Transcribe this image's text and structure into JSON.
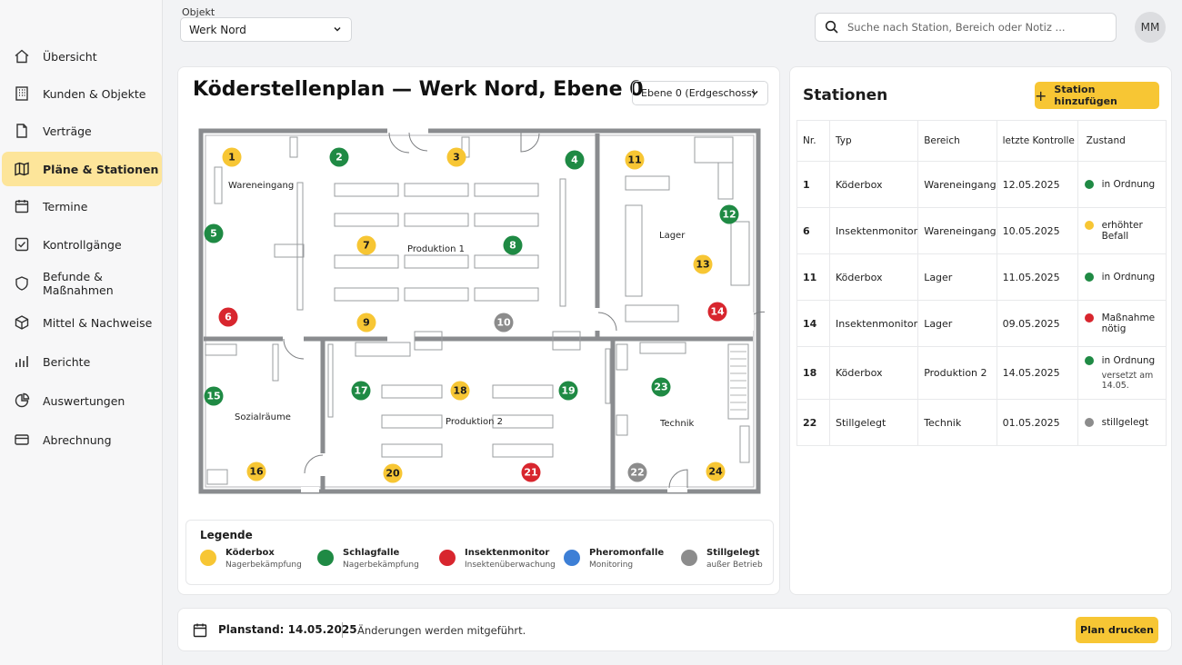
{
  "sidebar": {
    "items": [
      {
        "label": "Übersicht",
        "icon": "home-icon",
        "active": false
      },
      {
        "label": "Kunden & Objekte",
        "icon": "building-icon",
        "active": false
      },
      {
        "label": "Verträge",
        "icon": "document-icon",
        "active": false
      },
      {
        "label": "Pläne & Stationen",
        "icon": "map-icon",
        "active": true
      },
      {
        "label": "Termine",
        "icon": "calendar-icon",
        "active": false
      },
      {
        "label": "Kontrollgänge",
        "icon": "checkbox-icon",
        "active": false
      },
      {
        "label": "Befunde & Maßnahmen",
        "icon": "shield-icon",
        "active": false
      },
      {
        "label": "Mittel & Nachweise",
        "icon": "box-icon",
        "active": false
      },
      {
        "label": "Berichte",
        "icon": "bar-chart-icon",
        "active": false
      },
      {
        "label": "Auswertungen",
        "icon": "pie-chart-icon",
        "active": false
      },
      {
        "label": "Abrechnung",
        "icon": "credit-card-icon",
        "active": false
      }
    ]
  },
  "header": {
    "object_label": "Objekt",
    "object_value": "Werk Nord",
    "search_placeholder": "Suche nach Station, Bereich oder Notiz ...",
    "avatar_initials": "MM"
  },
  "plan": {
    "title": "Köderstellenplan — Werk Nord, Ebene 0",
    "level_value": "Ebene 0 (Erdgeschoss)",
    "rooms": {
      "wareneingang": "Wareneingang",
      "produktion1": "Produktion 1",
      "lager": "Lager",
      "sozialraeume": "Sozialräume",
      "produktion2": "Produktion 2",
      "technik": "Technik"
    },
    "stations": [
      {
        "nr": "1",
        "type": "koederbox"
      },
      {
        "nr": "2",
        "type": "schlagfalle"
      },
      {
        "nr": "3",
        "type": "koederbox"
      },
      {
        "nr": "4",
        "type": "schlagfalle"
      },
      {
        "nr": "5",
        "type": "schlagfalle"
      },
      {
        "nr": "6",
        "type": "insektenmonitor"
      },
      {
        "nr": "7",
        "type": "koederbox"
      },
      {
        "nr": "8",
        "type": "schlagfalle"
      },
      {
        "nr": "9",
        "type": "koederbox"
      },
      {
        "nr": "10",
        "type": "stillgelegt"
      },
      {
        "nr": "11",
        "type": "koederbox"
      },
      {
        "nr": "12",
        "type": "schlagfalle"
      },
      {
        "nr": "13",
        "type": "koederbox"
      },
      {
        "nr": "14",
        "type": "insektenmonitor"
      },
      {
        "nr": "15",
        "type": "schlagfalle"
      },
      {
        "nr": "16",
        "type": "koederbox"
      },
      {
        "nr": "17",
        "type": "schlagfalle"
      },
      {
        "nr": "18",
        "type": "koederbox"
      },
      {
        "nr": "19",
        "type": "schlagfalle"
      },
      {
        "nr": "20",
        "type": "koederbox"
      },
      {
        "nr": "21",
        "type": "insektenmonitor"
      },
      {
        "nr": "22",
        "type": "stillgelegt"
      },
      {
        "nr": "23",
        "type": "schlagfalle"
      },
      {
        "nr": "24",
        "type": "koederbox"
      }
    ],
    "legend": {
      "title": "Legende",
      "items": [
        {
          "name": "Köderbox",
          "sub": "Nagerbekämpfung",
          "color": "#f7c634"
        },
        {
          "name": "Schlagfalle",
          "sub": "Nagerbekämpfung",
          "color": "#1f8a44"
        },
        {
          "name": "Insektenmonitor",
          "sub": "Insektenüberwachung",
          "color": "#d8262e"
        },
        {
          "name": "Pheromonfalle",
          "sub": "Monitoring",
          "color": "#3d7fd6"
        },
        {
          "name": "Stillgelegt",
          "sub": "außer Betrieb",
          "color": "#8c8c8c"
        }
      ]
    }
  },
  "colors": {
    "koederbox": "#f7c634",
    "schlagfalle": "#1f8a44",
    "insektenmonitor": "#d8262e",
    "pheromonfalle": "#3d7fd6",
    "stillgelegt": "#8c8c8c",
    "accent": "#f7c634"
  },
  "stations_panel": {
    "title": "Stationen",
    "add_button": "Station hinzufügen",
    "columns": [
      "Nr.",
      "Typ",
      "Bereich",
      "letzte Kontrolle",
      "Zustand"
    ],
    "rows": [
      {
        "nr": "1",
        "typ": "Köderbox",
        "bereich": "Wareneingang",
        "kontrolle": "12.05.2025",
        "zustand": "in Ordnung",
        "zustand_sub": "",
        "status_color": "#1f8a44"
      },
      {
        "nr": "6",
        "typ": "Insektenmonitor",
        "bereich": "Wareneingang",
        "kontrolle": "10.05.2025",
        "zustand": "erhöhter Befall",
        "zustand_sub": "",
        "status_color": "#f7c634"
      },
      {
        "nr": "11",
        "typ": "Köderbox",
        "bereich": "Lager",
        "kontrolle": "11.05.2025",
        "zustand": "in Ordnung",
        "zustand_sub": "",
        "status_color": "#1f8a44"
      },
      {
        "nr": "14",
        "typ": "Insektenmonitor",
        "bereich": "Lager",
        "kontrolle": "09.05.2025",
        "zustand": "Maßnahme nötig",
        "zustand_sub": "",
        "status_color": "#d8262e"
      },
      {
        "nr": "18",
        "typ": "Köderbox",
        "bereich": "Produktion 2",
        "kontrolle": "14.05.2025",
        "zustand": "in Ordnung",
        "zustand_sub": "versetzt am 14.05.",
        "status_color": "#1f8a44"
      },
      {
        "nr": "22",
        "typ": "Stillgelegt",
        "bereich": "Technik",
        "kontrolle": "01.05.2025",
        "zustand": "stillgelegt",
        "zustand_sub": "",
        "status_color": "#8c8c8c"
      }
    ]
  },
  "footer": {
    "plan_stand": "Planstand: 14.05.2025",
    "note": "Änderungen werden mitgeführt.",
    "print_button": "Plan drucken"
  }
}
